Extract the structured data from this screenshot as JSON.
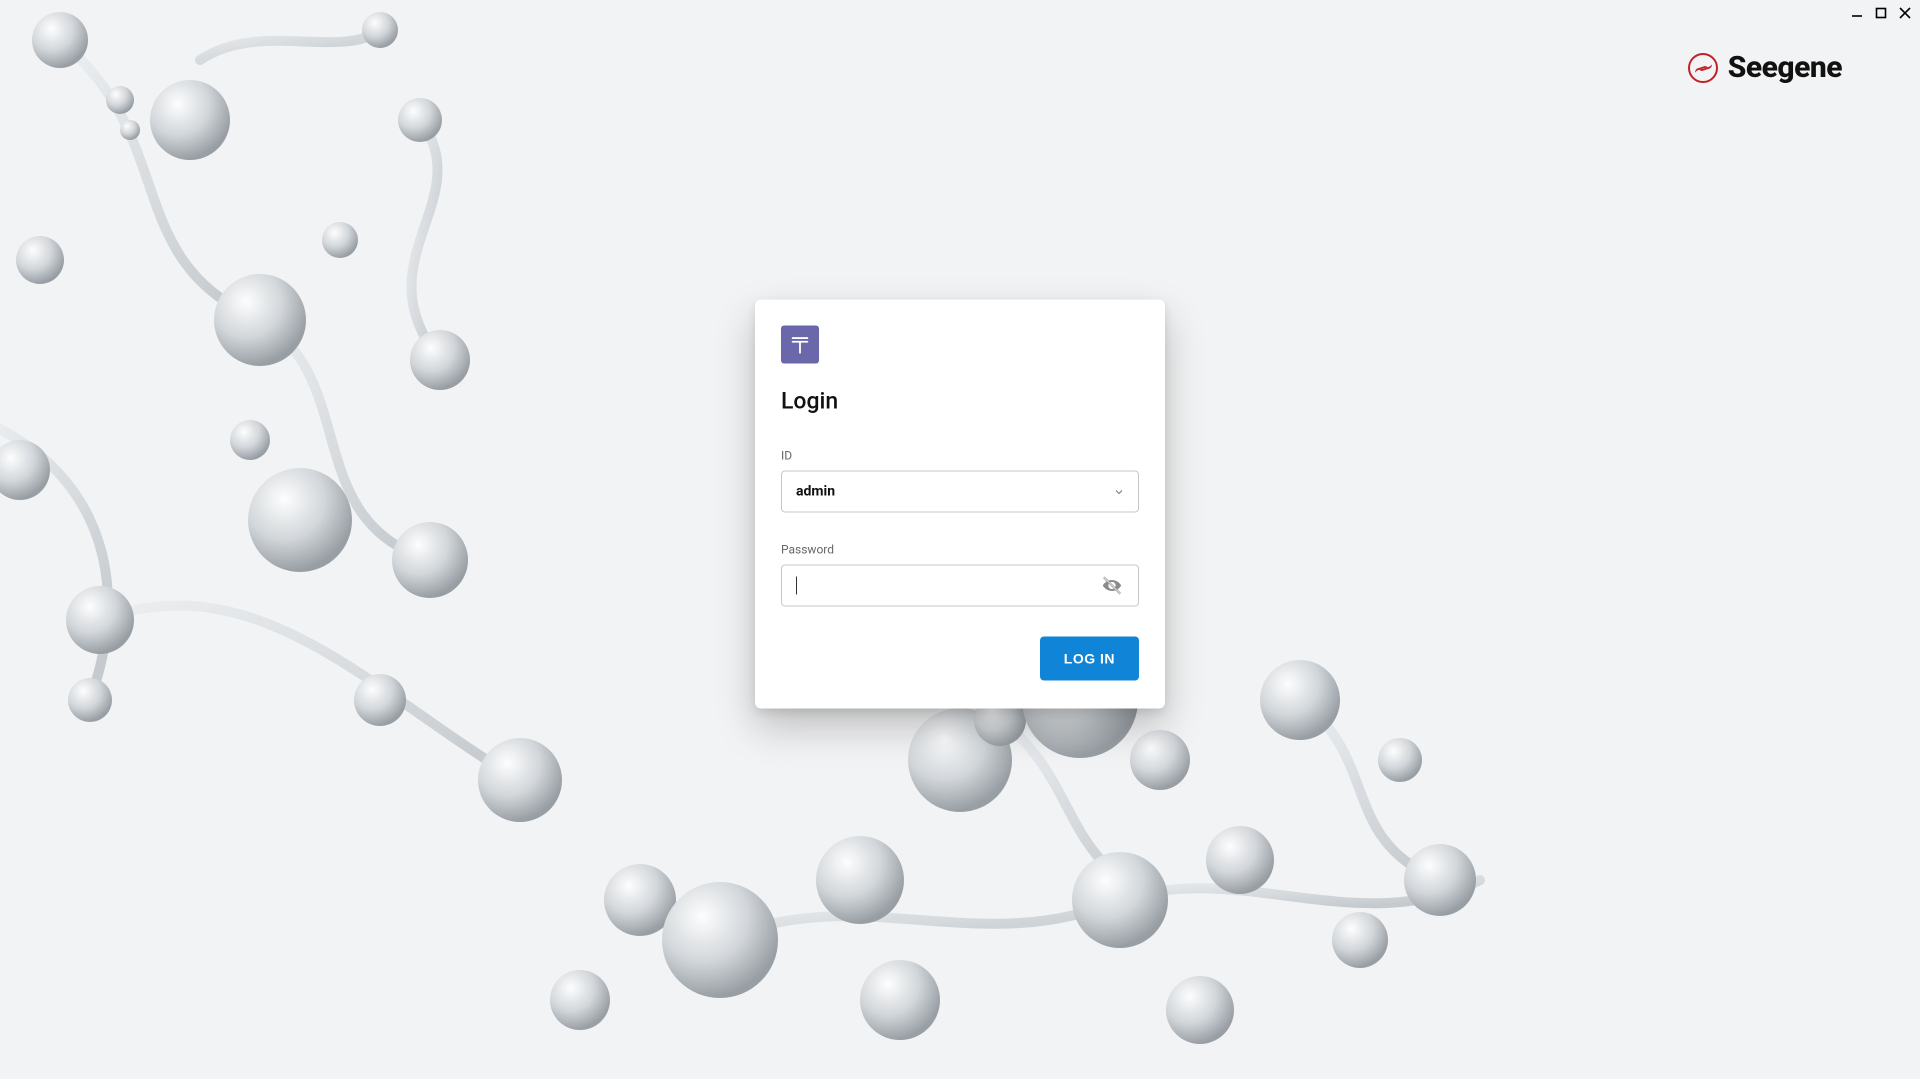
{
  "window": {
    "minimize_tooltip": "Minimize",
    "maximize_tooltip": "Maximize",
    "close_tooltip": "Close"
  },
  "brand": {
    "name": "Seegene"
  },
  "login": {
    "app_badge": "T",
    "title": "Login",
    "id_label": "ID",
    "id_value": "admin",
    "password_label": "Password",
    "password_value": "",
    "password_placeholder": "",
    "toggle_password_tooltip": "Show password",
    "submit_label": "LOG IN"
  }
}
